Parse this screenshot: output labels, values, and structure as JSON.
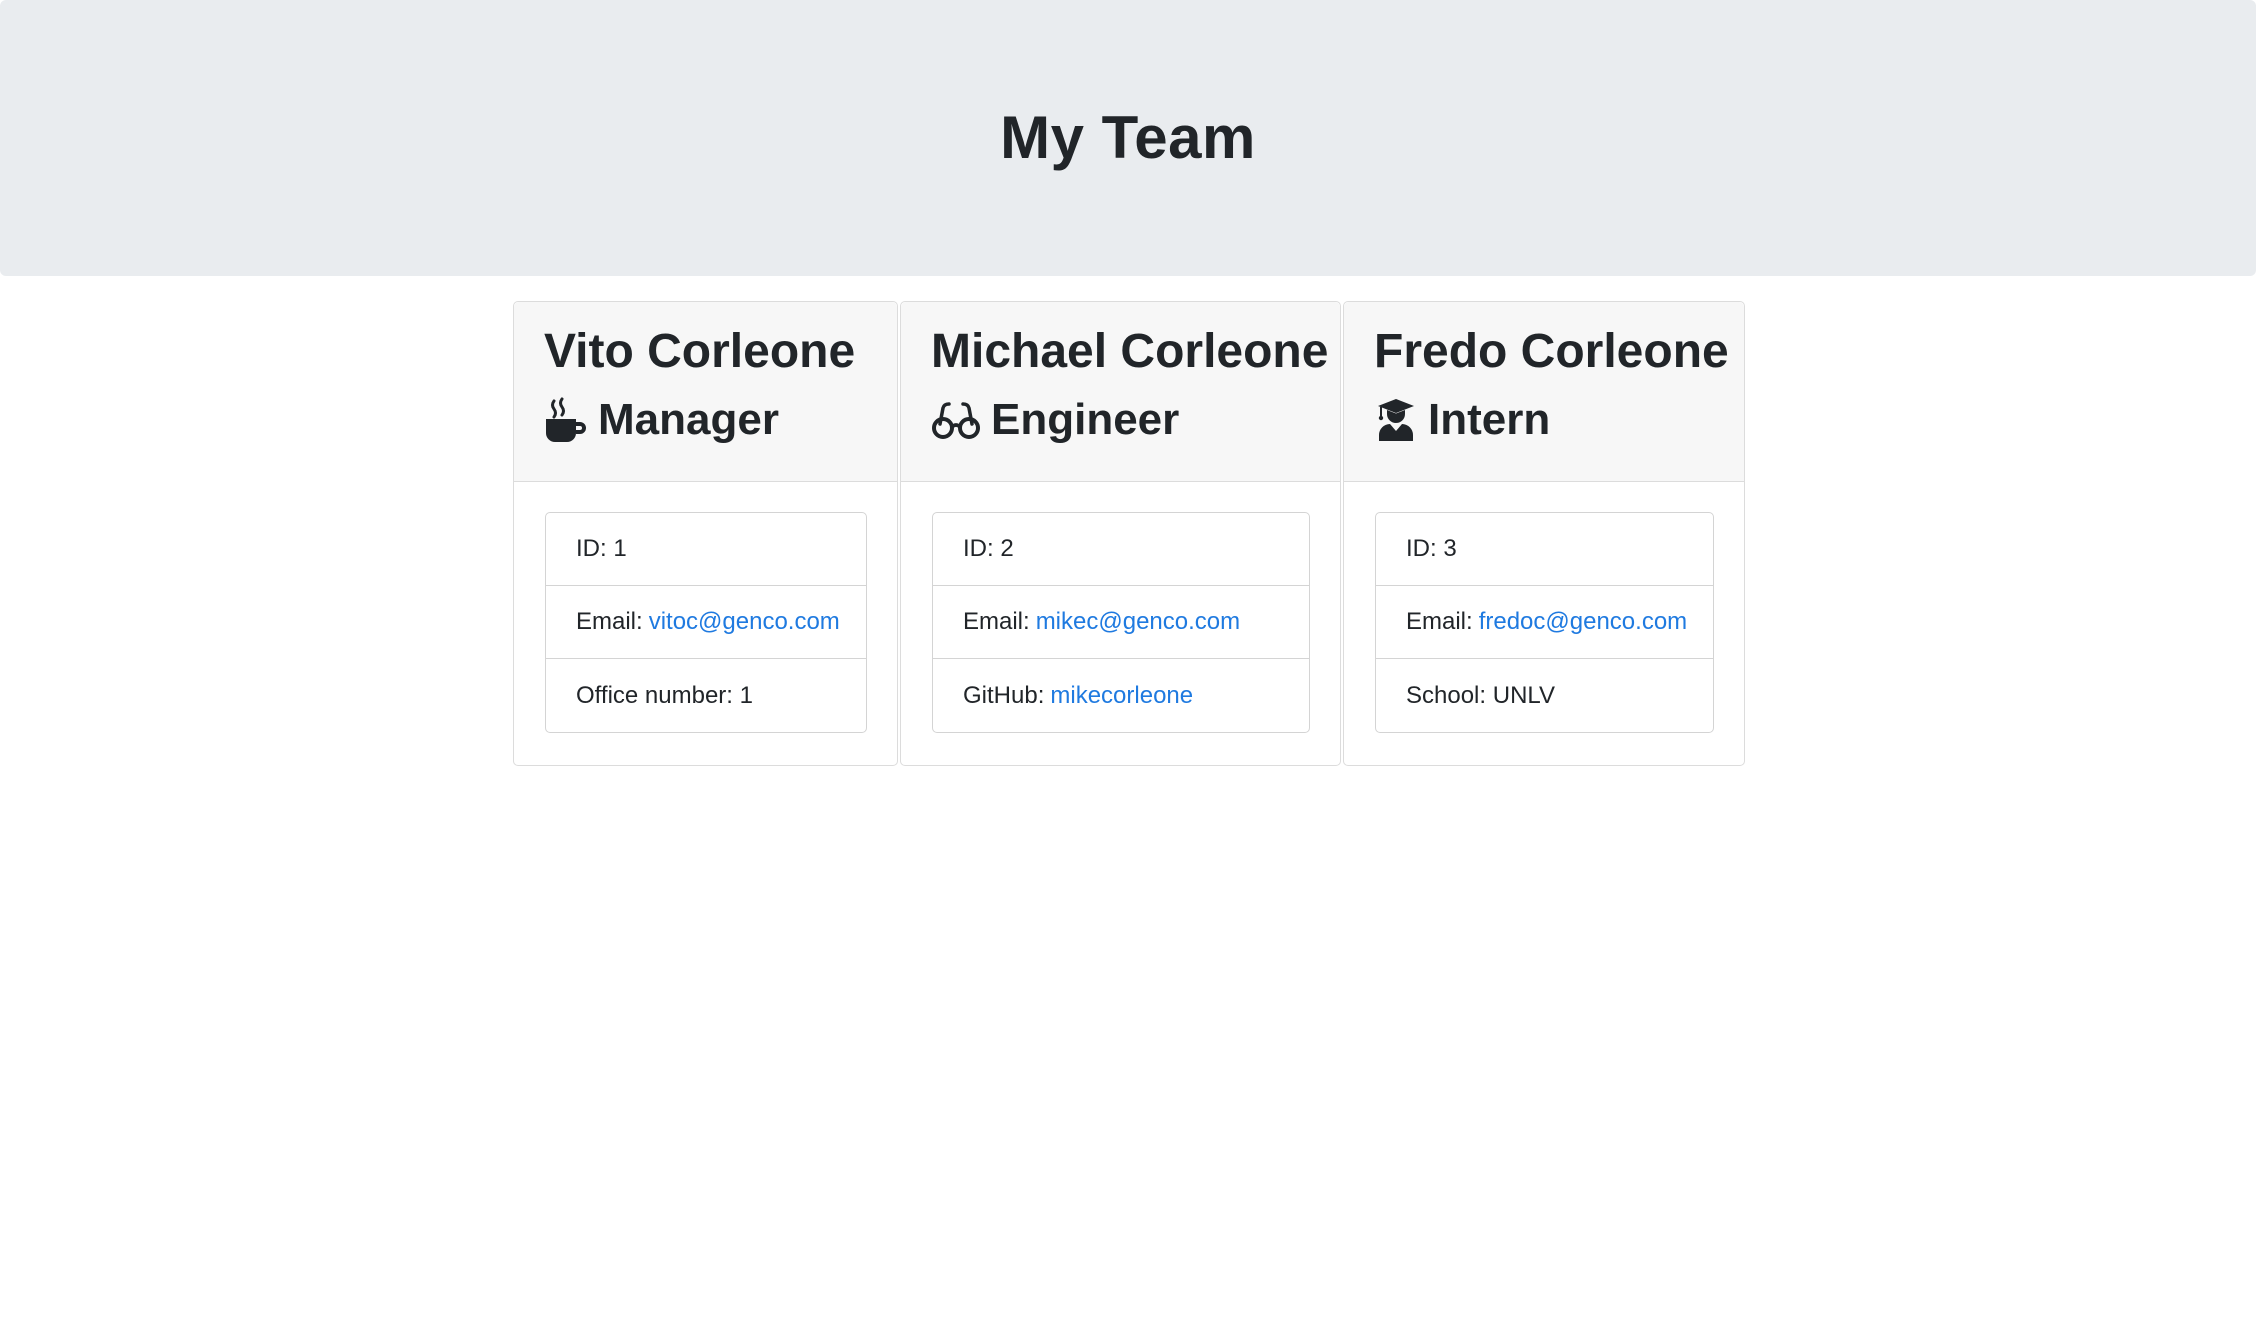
{
  "header": {
    "title": "My Team"
  },
  "employees": [
    {
      "name": "Vito Corleone",
      "role": "Manager",
      "role_icon": "mug-icon",
      "id_label": "ID:",
      "id": "1",
      "email_label": "Email:",
      "email": "vitoc@genco.com",
      "extra_label": "Office number:",
      "extra_value": "1"
    },
    {
      "name": "Michael Corleone",
      "role": "Engineer",
      "role_icon": "glasses-icon",
      "id_label": "ID:",
      "id": "2",
      "email_label": "Email:",
      "email": "mikec@genco.com",
      "extra_label": "GitHub:",
      "extra_value": "mikecorleone"
    },
    {
      "name": "Fredo Corleone",
      "role": "Intern",
      "role_icon": "graduate-icon",
      "id_label": "ID:",
      "id": "3",
      "email_label": "Email:",
      "email": "fredoc@genco.com",
      "extra_label": "School:",
      "extra_value": "UNLV"
    }
  ],
  "colors": {
    "link": "#1f7ae0",
    "jumbotron_bg": "#e9ecef",
    "card_header_bg": "#f7f7f7",
    "text": "#212529"
  }
}
